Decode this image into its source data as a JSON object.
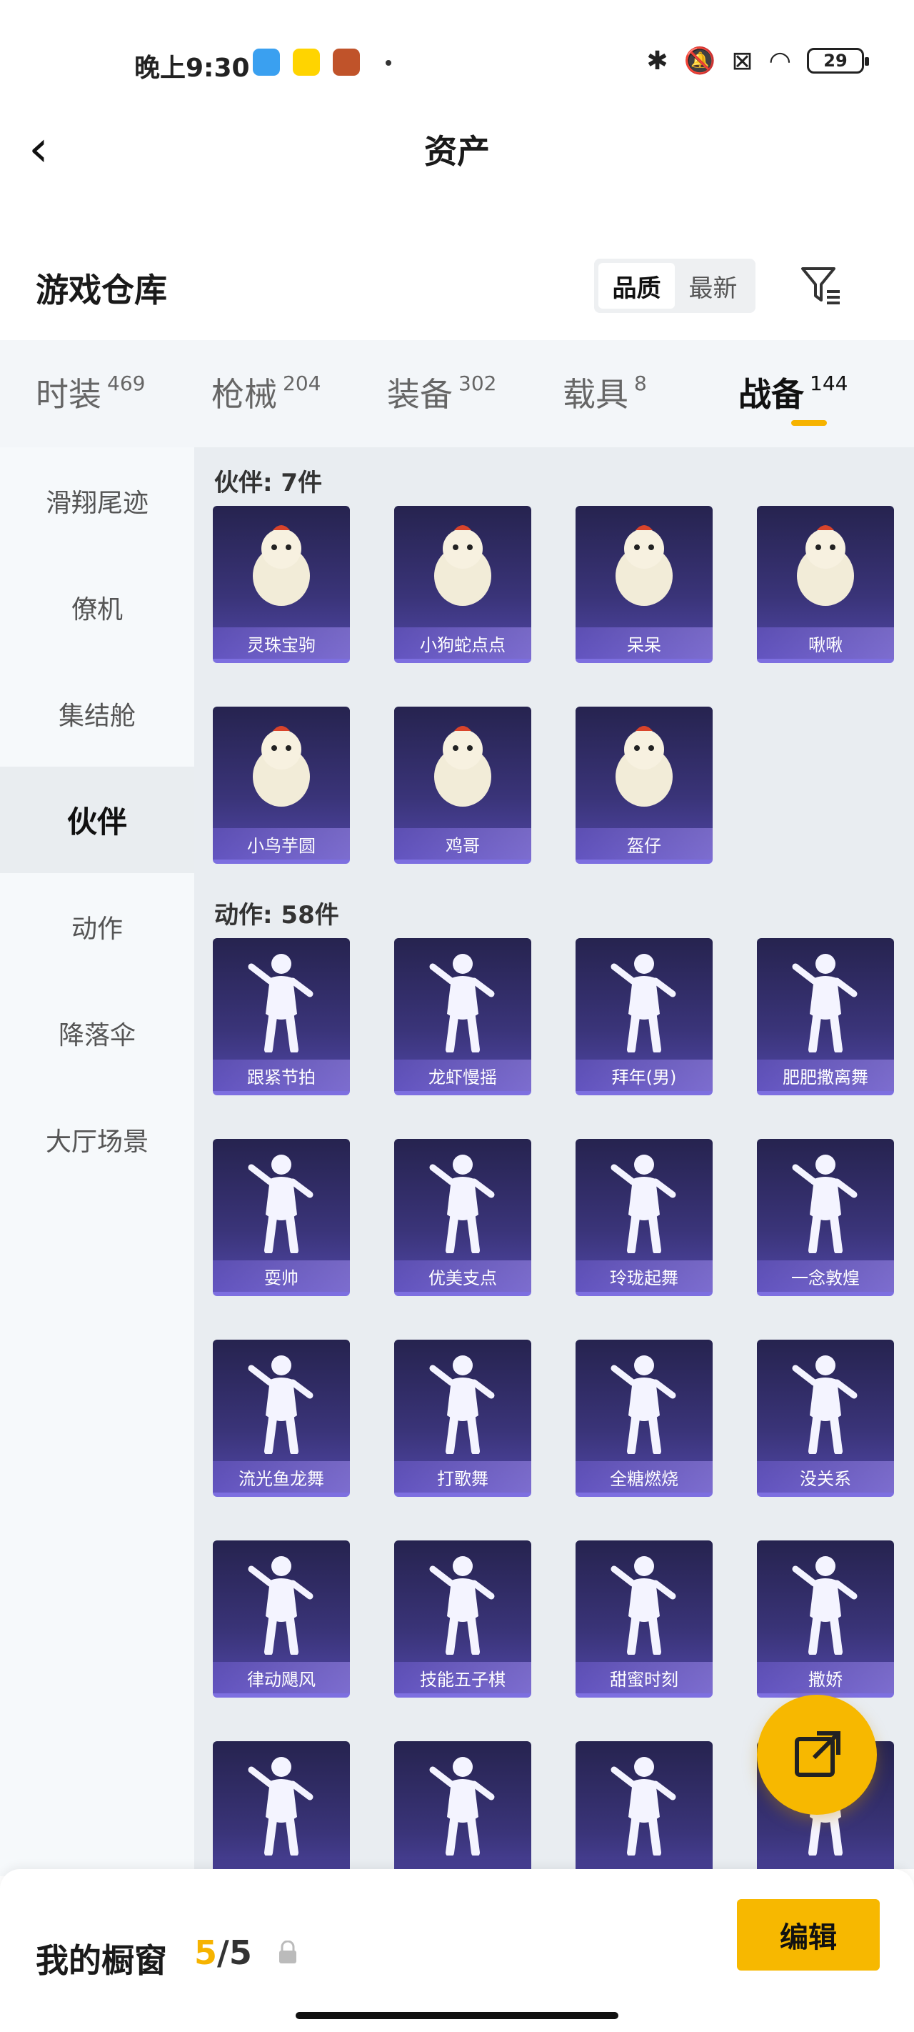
{
  "status_bar": {
    "time": "晚上9:30",
    "battery": "29"
  },
  "header": {
    "title": "资产"
  },
  "warehouse": {
    "title": "游戏仓库",
    "sort_options": [
      "品质",
      "最新"
    ],
    "active_sort": "品质"
  },
  "tabs": [
    {
      "label": "时装",
      "count": "469"
    },
    {
      "label": "枪械",
      "count": "204"
    },
    {
      "label": "装备",
      "count": "302"
    },
    {
      "label": "载具",
      "count": "8"
    },
    {
      "label": "战备",
      "count": "144"
    }
  ],
  "active_tab": "战备",
  "sidebar": [
    "滑翔尾迹",
    "僚机",
    "集结舱",
    "伙伴",
    "动作",
    "降落伞",
    "大厅场景"
  ],
  "active_sidebar": "伙伴",
  "groups": [
    {
      "title": "伙伴: 7件",
      "items": [
        "灵珠宝驹",
        "小狗蛇点点",
        "呆呆",
        "啾啾",
        "小鸟芋圆",
        "鸡哥",
        "盔仔"
      ]
    },
    {
      "title": "动作: 58件",
      "items": [
        "跟紧节拍",
        "龙虾慢摇",
        "拜年(男)",
        "肥肥撒离舞",
        "耍帅",
        "优美支点",
        "玲珑起舞",
        "一念敦煌",
        "流光鱼龙舞",
        "打歌舞",
        "全糖燃烧",
        "没关系",
        "律动飓风",
        "技能五子棋",
        "甜蜜时刻",
        "撒娇",
        "",
        "",
        "",
        ""
      ]
    }
  ],
  "showcase": {
    "title": "我的橱窗",
    "current": "5",
    "total": "/5",
    "edit_label": "编辑"
  },
  "colors": {
    "accent": "#f7b800",
    "card_bg": "#3a3479"
  }
}
